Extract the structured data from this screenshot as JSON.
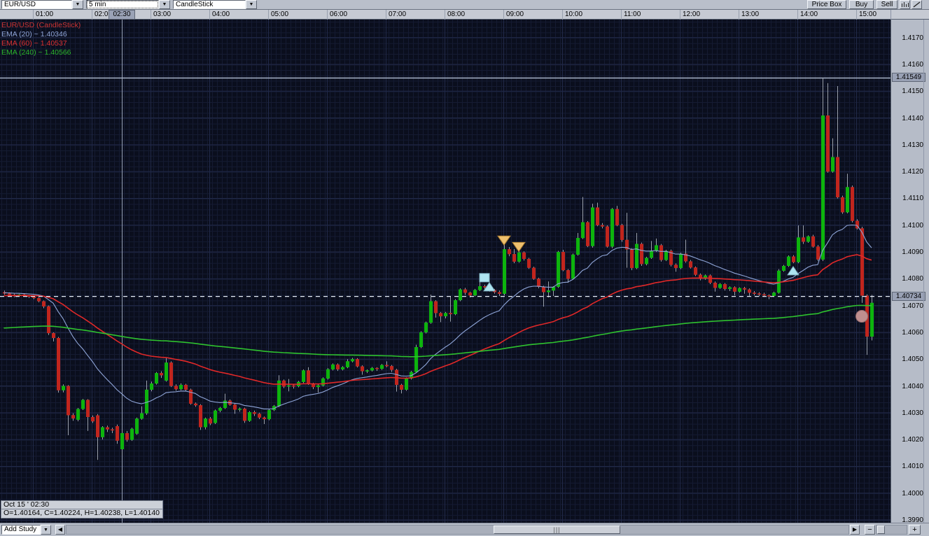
{
  "toolbar": {
    "symbol_select": "EUR/USD",
    "interval_select": "5 min",
    "style_select": "CandleStick",
    "price_box_label": "Price Box",
    "buy_label": "Buy",
    "sell_label": "Sell",
    "dropdown_arrow": "▼"
  },
  "time_axis": {
    "labels": [
      "01:00",
      "02:00",
      "03:00",
      "04:00",
      "05:00",
      "06:00",
      "07:00",
      "08:00",
      "09:00",
      "10:00",
      "11:00",
      "12:00",
      "13:00",
      "14:00",
      "15:00"
    ],
    "highlighted_label": "02:30"
  },
  "price_axis": {
    "labels": [
      "1.4170",
      "1.4160",
      "1.4150",
      "1.4140",
      "1.4130",
      "1.4120",
      "1.4110",
      "1.4100",
      "1.4090",
      "1.4080",
      "1.4070",
      "1.4060",
      "1.4050",
      "1.4040",
      "1.4030",
      "1.4020",
      "1.4010",
      "1.4000",
      "1.3990"
    ],
    "high_tag": "1.41549",
    "last_tag": "1.40734"
  },
  "legend": {
    "rows": [
      {
        "text": "EUR/USD (CandleStick)",
        "color": "#cc3434"
      },
      {
        "text": "EMA (20) ~ 1.40346",
        "color": "#8fa5d8"
      },
      {
        "text": "EMA (60) ~ 1.40537",
        "color": "#d93030"
      },
      {
        "text": "EMA (240) ~ 1.40566",
        "color": "#2bb52b"
      }
    ]
  },
  "tooltip": {
    "line1": "Oct 15 ' 02:30",
    "line2": "O=1.40164, C=1.40224, H=1.40238, L=1.40140"
  },
  "bottom_bar": {
    "add_study_label": "Add Study",
    "dropdown_arrow": "▼",
    "scroll_left_icon": "◀",
    "scroll_right_icon": "▶",
    "zoom_out_label": "−",
    "zoom_in_label": "+",
    "thumb_grip": "|||"
  },
  "chart_data": {
    "type": "candlestick",
    "symbol": "EUR/USD",
    "interval": "5 min",
    "date": "Oct 15",
    "start_time": "00:30",
    "step_minutes": 5,
    "price_base": 1.4,
    "price_unit": 1e-05,
    "note": "candles are [open,high,low,close] in units of 0.00001 above 1.40000",
    "candles": [
      [
        750,
        756,
        741,
        745
      ],
      [
        745,
        749,
        736,
        740
      ],
      [
        740,
        744,
        731,
        736
      ],
      [
        736,
        743,
        733,
        741
      ],
      [
        741,
        744,
        733,
        737
      ],
      [
        737,
        740,
        728,
        733
      ],
      [
        733,
        737,
        724,
        728
      ],
      [
        728,
        731,
        712,
        716
      ],
      [
        716,
        719,
        690,
        697
      ],
      [
        697,
        700,
        590,
        597
      ],
      [
        597,
        600,
        566,
        579
      ],
      [
        579,
        583,
        375,
        384
      ],
      [
        384,
        406,
        376,
        400
      ],
      [
        400,
        403,
        216,
        291
      ],
      [
        291,
        298,
        270,
        279
      ],
      [
        274,
        318,
        268,
        314
      ],
      [
        314,
        352,
        310,
        348
      ],
      [
        348,
        351,
        232,
        284
      ],
      [
        284,
        290,
        262,
        268
      ],
      [
        290,
        295,
        124,
        209
      ],
      [
        209,
        250,
        200,
        246
      ],
      [
        246,
        252,
        228,
        238
      ],
      [
        238,
        244,
        224,
        236
      ],
      [
        250,
        256,
        184,
        196
      ],
      [
        164,
        238,
        140,
        224
      ],
      [
        224,
        232,
        192,
        199
      ],
      [
        199,
        244,
        195,
        240
      ],
      [
        222,
        282,
        218,
        278
      ],
      [
        278,
        324,
        274,
        298
      ],
      [
        298,
        420,
        292,
        386
      ],
      [
        386,
        416,
        380,
        409
      ],
      [
        409,
        452,
        405,
        448
      ],
      [
        448,
        455,
        430,
        440
      ],
      [
        420,
        504,
        416,
        487
      ],
      [
        487,
        492,
        396,
        400
      ],
      [
        400,
        406,
        382,
        388
      ],
      [
        388,
        410,
        384,
        404
      ],
      [
        404,
        408,
        380,
        386
      ],
      [
        386,
        390,
        330,
        334
      ],
      [
        334,
        338,
        322,
        328
      ],
      [
        328,
        332,
        236,
        246
      ],
      [
        246,
        282,
        238,
        278
      ],
      [
        278,
        284,
        254,
        260
      ],
      [
        262,
        312,
        258,
        308
      ],
      [
        308,
        322,
        302,
        318
      ],
      [
        318,
        371,
        314,
        345
      ],
      [
        345,
        350,
        326,
        330
      ],
      [
        330,
        334,
        296,
        312
      ],
      [
        312,
        320,
        304,
        315
      ],
      [
        315,
        319,
        262,
        270
      ],
      [
        270,
        306,
        266,
        302
      ],
      [
        302,
        308,
        288,
        296
      ],
      [
        296,
        300,
        276,
        282
      ],
      [
        282,
        286,
        258,
        276
      ],
      [
        276,
        314,
        272,
        310
      ],
      [
        310,
        329,
        306,
        325
      ],
      [
        325,
        440,
        321,
        420
      ],
      [
        420,
        424,
        392,
        398
      ],
      [
        398,
        426,
        380,
        402
      ],
      [
        402,
        406,
        390,
        399
      ],
      [
        399,
        419,
        395,
        415
      ],
      [
        415,
        462,
        411,
        458
      ],
      [
        458,
        470,
        404,
        408
      ],
      [
        408,
        412,
        388,
        396
      ],
      [
        396,
        406,
        375,
        402
      ],
      [
        402,
        432,
        398,
        428
      ],
      [
        428,
        466,
        424,
        462
      ],
      [
        462,
        484,
        458,
        480
      ],
      [
        480,
        484,
        456,
        462
      ],
      [
        462,
        474,
        458,
        470
      ],
      [
        470,
        500,
        466,
        492
      ],
      [
        492,
        505,
        488,
        500
      ],
      [
        500,
        504,
        469,
        473
      ],
      [
        473,
        477,
        442,
        455
      ],
      [
        455,
        462,
        448,
        458
      ],
      [
        458,
        471,
        454,
        467
      ],
      [
        467,
        470,
        456,
        464
      ],
      [
        464,
        482,
        460,
        478
      ],
      [
        478,
        492,
        470,
        474
      ],
      [
        474,
        478,
        452,
        460
      ],
      [
        460,
        464,
        379,
        404
      ],
      [
        404,
        408,
        372,
        386
      ],
      [
        386,
        432,
        382,
        428
      ],
      [
        428,
        456,
        424,
        452
      ],
      [
        452,
        554,
        448,
        545
      ],
      [
        545,
        604,
        541,
        600
      ],
      [
        600,
        640,
        596,
        636
      ],
      [
        636,
        741,
        632,
        716
      ],
      [
        716,
        720,
        655,
        672
      ],
      [
        672,
        676,
        638,
        660
      ],
      [
        660,
        676,
        652,
        672
      ],
      [
        672,
        735,
        640,
        668
      ],
      [
        668,
        724,
        664,
        720
      ],
      [
        720,
        764,
        716,
        760
      ],
      [
        760,
        766,
        740,
        748
      ],
      [
        748,
        752,
        730,
        738
      ],
      [
        738,
        762,
        734,
        758
      ],
      [
        758,
        800,
        754,
        772
      ],
      [
        772,
        778,
        756,
        768
      ],
      [
        768,
        772,
        752,
        758
      ],
      [
        758,
        762,
        744,
        750
      ],
      [
        750,
        756,
        735,
        744
      ],
      [
        744,
        929,
        738,
        910
      ],
      [
        910,
        918,
        884,
        892
      ],
      [
        892,
        911,
        858,
        864
      ],
      [
        864,
        915,
        860,
        898
      ],
      [
        898,
        902,
        868,
        874
      ],
      [
        874,
        878,
        837,
        841
      ],
      [
        841,
        845,
        796,
        800
      ],
      [
        800,
        804,
        764,
        770
      ],
      [
        770,
        774,
        696,
        750
      ],
      [
        750,
        790,
        730,
        756
      ],
      [
        756,
        772,
        735,
        770
      ],
      [
        770,
        904,
        766,
        900
      ],
      [
        900,
        908,
        828,
        832
      ],
      [
        832,
        836,
        785,
        800
      ],
      [
        800,
        894,
        796,
        890
      ],
      [
        890,
        971,
        886,
        952
      ],
      [
        952,
        1105,
        948,
        1011
      ],
      [
        1011,
        1015,
        918,
        922
      ],
      [
        922,
        1080,
        916,
        1066
      ],
      [
        1066,
        1084,
        996,
        1000
      ],
      [
        1000,
        1008,
        988,
        995
      ],
      [
        995,
        999,
        916,
        920
      ],
      [
        920,
        1064,
        914,
        1060
      ],
      [
        1060,
        1072,
        996,
        1000
      ],
      [
        1000,
        1005,
        938,
        945
      ],
      [
        945,
        1046,
        841,
        910
      ],
      [
        910,
        914,
        832,
        840
      ],
      [
        840,
        971,
        836,
        930
      ],
      [
        930,
        935,
        848,
        855
      ],
      [
        855,
        882,
        850,
        878
      ],
      [
        878,
        941,
        874,
        905
      ],
      [
        905,
        950,
        900,
        925
      ],
      [
        925,
        930,
        864,
        870
      ],
      [
        870,
        908,
        866,
        904
      ],
      [
        904,
        909,
        846,
        852
      ],
      [
        852,
        857,
        826,
        840
      ],
      [
        840,
        897,
        836,
        893
      ],
      [
        893,
        946,
        860,
        865
      ],
      [
        865,
        870,
        838,
        842
      ],
      [
        842,
        846,
        810,
        815
      ],
      [
        815,
        820,
        794,
        800
      ],
      [
        800,
        816,
        796,
        812
      ],
      [
        812,
        816,
        780,
        785
      ],
      [
        785,
        790,
        752,
        766
      ],
      [
        766,
        784,
        762,
        780
      ],
      [
        780,
        784,
        756,
        762
      ],
      [
        762,
        772,
        754,
        768
      ],
      [
        768,
        772,
        738,
        752
      ],
      [
        752,
        768,
        748,
        765
      ],
      [
        765,
        770,
        744,
        760
      ],
      [
        760,
        764,
        736,
        748
      ],
      [
        748,
        754,
        738,
        745
      ],
      [
        745,
        750,
        734,
        742
      ],
      [
        742,
        748,
        732,
        738
      ],
      [
        738,
        742,
        724,
        736
      ],
      [
        736,
        752,
        732,
        748
      ],
      [
        748,
        836,
        744,
        830
      ],
      [
        830,
        852,
        826,
        848
      ],
      [
        848,
        887,
        844,
        883
      ],
      [
        883,
        888,
        858,
        862
      ],
      [
        862,
        999,
        858,
        954
      ],
      [
        954,
        999,
        930,
        938
      ],
      [
        938,
        962,
        934,
        958
      ],
      [
        958,
        964,
        916,
        920
      ],
      [
        920,
        926,
        866,
        872
      ],
      [
        872,
        1549,
        866,
        1409
      ],
      [
        1409,
        1530,
        1196,
        1200
      ],
      [
        1200,
        1324,
        1196,
        1254
      ],
      [
        1254,
        1519,
        1100,
        1104
      ],
      [
        1104,
        1110,
        1042,
        1048
      ],
      [
        1048,
        1192,
        1044,
        1142
      ],
      [
        1142,
        1148,
        1010,
        1016
      ],
      [
        1016,
        1022,
        984,
        988
      ],
      [
        988,
        994,
        710,
        737
      ],
      [
        737,
        742,
        516,
        584
      ],
      [
        584,
        740,
        570,
        710
      ]
    ],
    "emas": [
      {
        "period": 20,
        "seed": 748,
        "color": "#8fa5d8",
        "width": 1.1
      },
      {
        "period": 60,
        "seed": 737,
        "color": "#e02828",
        "width": 1.6
      },
      {
        "period": 240,
        "seed": 615,
        "color": "#2ec22e",
        "width": 1.6
      }
    ],
    "overlays": {
      "high_line_price": 1.41549,
      "last_price_dashed": 1.40734,
      "crosshair_time": "02:30"
    },
    "markers": [
      {
        "type": "square",
        "i": 98,
        "v": 804,
        "color": "cyan"
      },
      {
        "type": "triangle-up",
        "i": 99,
        "v": 770,
        "color": "cyan"
      },
      {
        "type": "triangle-down",
        "i": 102,
        "v": 944,
        "color": "orange"
      },
      {
        "type": "triangle-down",
        "i": 105,
        "v": 920,
        "color": "orange"
      },
      {
        "type": "triangle-up",
        "i": 161,
        "v": 830,
        "color": "cyan"
      },
      {
        "type": "circle",
        "i": 175,
        "v": 660,
        "color": "salmon"
      }
    ],
    "marker_colors": {
      "cyan": "#aee4f0",
      "orange": "#eec06e",
      "salmon": "#bf8f8f"
    },
    "colors": {
      "up": "#0db40d",
      "down": "#c1251d",
      "wick": "#9ba1ad",
      "background": "#0a0e1d",
      "grid_fine": "#151b32",
      "grid_strong": "#212948",
      "dashed_line": "#e6ecf6",
      "high_line": "#a9b4c9",
      "crosshair": "#97a1b6"
    },
    "ylim": [
      1.3989,
      1.41767
    ],
    "xlabel": "time",
    "ylabel": "price"
  }
}
